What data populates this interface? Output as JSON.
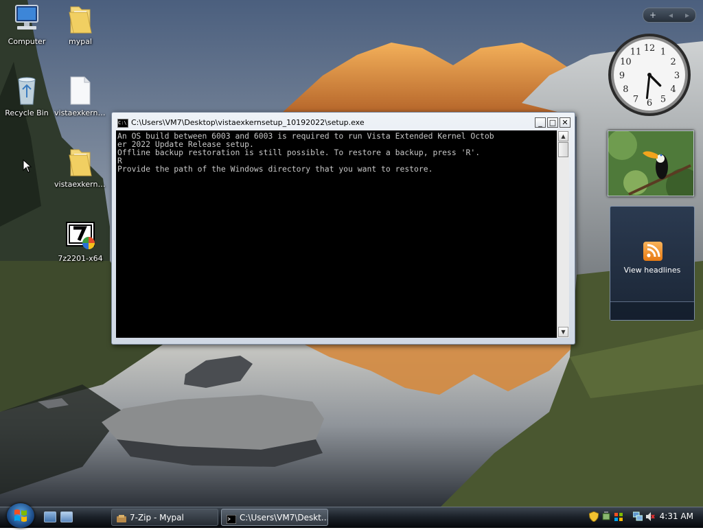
{
  "desktop": {
    "icons": [
      {
        "label": "Computer"
      },
      {
        "label": "mypal"
      },
      {
        "label": "Recycle Bin"
      },
      {
        "label": "vistaexkerns..."
      },
      {
        "label": "vistaexkerns..."
      },
      {
        "label": "7z2201-x64"
      }
    ]
  },
  "sidebar": {
    "controls": {
      "add": "+",
      "prev": "◂",
      "next": "▸"
    },
    "clock": {
      "numerals": [
        "12",
        "1",
        "2",
        "3",
        "4",
        "5",
        "6",
        "7",
        "8",
        "9",
        "10",
        "11"
      ],
      "hour_hand": 4.5,
      "minute_hand": 31
    },
    "feed": {
      "label": "View headlines"
    }
  },
  "console": {
    "title": "C:\\Users\\VM7\\Desktop\\vistaexkernsetup_10192022\\setup.exe",
    "icon_text": "C:\\",
    "buttons": {
      "minimize": "_",
      "maximize": "□",
      "close": "✕"
    },
    "lines": [
      "An OS build between 6003 and 6003 is required to run Vista Extended Kernel Octob",
      "er 2022 Update Release setup.",
      "Offline backup restoration is still possible. To restore a backup, press 'R'.",
      "R",
      "Provide the path of the Windows directory that you want to restore."
    ],
    "scroll": {
      "up": "▲",
      "down": "▼"
    }
  },
  "taskbar": {
    "tasks": [
      {
        "label": "7-Zip - Mypal"
      },
      {
        "label": "C:\\Users\\VM7\\Deskt..."
      }
    ],
    "clock": "4:31 AM"
  },
  "colors": {
    "console_bg": "#000000",
    "console_fg": "#c8c8c8",
    "taskbar": "#1c222a",
    "feed_orange": "#f39a2b"
  }
}
